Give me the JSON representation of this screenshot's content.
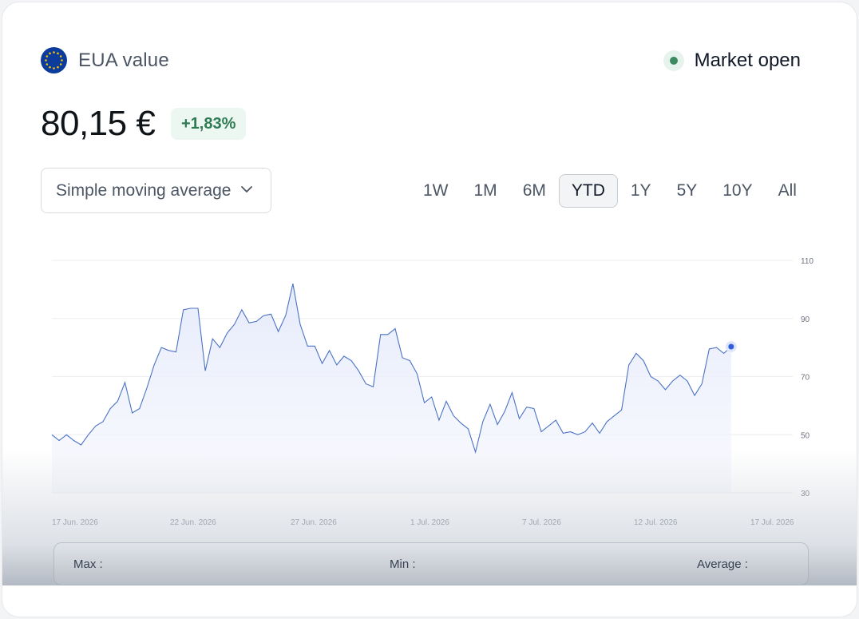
{
  "header": {
    "asset_name": "EUA value",
    "flag_icon": "eu-flag-icon",
    "market_status": "Market open",
    "status_color": "#3c8a62"
  },
  "price": {
    "value": "80,15 €",
    "change": "+1,83%",
    "change_color": "#2e7a52"
  },
  "indicator_select": {
    "selected": "Simple moving average",
    "icon": "chevron-down-icon"
  },
  "time_ranges": {
    "options": [
      "1W",
      "1M",
      "6M",
      "YTD",
      "1Y",
      "5Y",
      "10Y",
      "All"
    ],
    "selected": "YTD"
  },
  "stats": {
    "max_label": "Max :",
    "min_label": "Min :",
    "avg_label": "Average :"
  },
  "chart_data": {
    "type": "area",
    "line_color": "#4a72c4",
    "fill_color": "#e9edfb",
    "ylim": [
      30,
      110
    ],
    "yticks": [
      30,
      50,
      70,
      90,
      110
    ],
    "y_axis_side": "right",
    "grid": true,
    "x_tick_labels": [
      "17 Jun. 2026",
      "22 Jun. 2026",
      "27 Jun. 2026",
      "1 Jul. 2026",
      "7 Jul. 2026",
      "12 Jul. 2026",
      "17 Jul. 2026"
    ],
    "x_ticks_days": [
      0,
      5,
      10,
      14,
      20,
      25,
      30
    ],
    "series": [
      {
        "x_days": [
          0,
          0.3,
          0.6,
          0.9,
          1.2,
          1.5,
          1.8,
          2.1,
          2.4,
          2.7,
          3.0,
          3.3,
          3.6,
          3.9,
          4.2,
          4.5,
          4.8,
          5.1,
          5.4,
          5.7,
          6.0,
          6.3,
          6.6,
          6.9,
          7.2,
          7.5,
          7.8,
          8.1,
          8.4,
          8.7,
          9.0,
          9.3,
          9.6,
          9.9,
          10.2,
          10.5,
          10.8,
          11.1,
          11.4,
          11.7,
          12.0,
          12.3,
          12.6,
          12.9,
          13.2,
          13.5,
          13.8,
          14.1,
          14.4,
          14.7,
          15.0,
          15.3,
          15.6,
          15.9,
          16.2,
          16.5,
          16.8,
          17.1,
          17.4,
          17.7,
          18.0,
          18.3,
          18.6,
          18.9,
          19.2,
          19.5,
          19.8,
          20.1,
          20.4,
          20.7,
          21.0,
          21.3,
          21.6,
          21.9,
          22.2,
          22.5,
          22.8,
          23.1,
          23.4,
          23.7,
          24.0,
          24.3,
          24.6,
          24.9,
          25.2,
          25.5,
          25.8,
          26.1,
          26.4,
          26.7,
          27.0,
          27.3,
          27.6,
          27.9,
          28.2,
          28.5,
          28.8,
          29.1,
          29.4,
          29.7,
          30.0,
          30.3,
          30.6,
          30.9,
          31.2
        ],
        "y": [
          50.0,
          48.0,
          50.0,
          48.0,
          46.5,
          50.0,
          53.0,
          54.5,
          59.0,
          61.5,
          68.0,
          57.5,
          59.0,
          66.0,
          74.0,
          80.0,
          79.0,
          78.5,
          93.0,
          93.5,
          93.5,
          72.0,
          83.0,
          80.0,
          85.0,
          88.0,
          93.0,
          88.5,
          89.0,
          91.0,
          91.5,
          85.5,
          91.0,
          102.0,
          88.0,
          80.5,
          80.5,
          74.5,
          79.0,
          74.0,
          77.0,
          75.5,
          72.0,
          67.5,
          66.5,
          84.5,
          84.5,
          86.5,
          76.5,
          75.5,
          71.0,
          61.0,
          63.0,
          55.0,
          61.5,
          56.5,
          54.0,
          52.0,
          44.0,
          54.5,
          60.5,
          53.5,
          58.0,
          64.5,
          55.5,
          59.5,
          59.0,
          51.0,
          53.0,
          55.0,
          50.5,
          51.0,
          50.0,
          51.0,
          54.0,
          50.5,
          54.5,
          56.5,
          58.5,
          74.0,
          78.0,
          75.5,
          70.0,
          68.5,
          65.5,
          68.5,
          70.5,
          68.5,
          63.5,
          67.5,
          79.5,
          80.0,
          78.0,
          80.3
        ]
      }
    ]
  }
}
